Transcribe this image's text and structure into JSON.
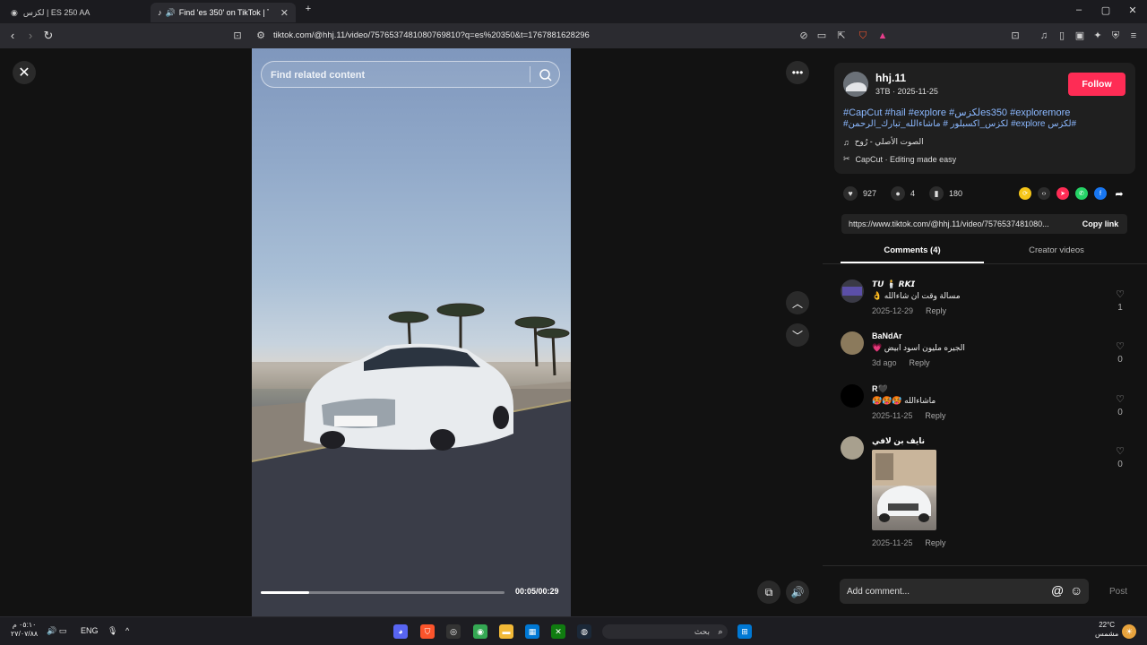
{
  "browser": {
    "tabs": [
      {
        "label": "لكزس | ES 250 AA"
      },
      {
        "label": "Find 'es 350' on TikTok | TikTok"
      }
    ],
    "url": "tiktok.com/@hhj.11/video/7576537481080769810?q=es%20350&t=1767881628296"
  },
  "video": {
    "search_placeholder": "Find related content",
    "progress": 0.2,
    "time": "00:05/00:29"
  },
  "post": {
    "username": "hhj.11",
    "subline": "3TB · 2025-11-25",
    "follow_label": "Follow",
    "caption_line1": "#CapCut #hail #explore #لكزسes350 #exploremore",
    "caption_line2": "#لكزس explore# لكزس_اكسبلور # ماشاءالله_تبارك_الرحمن#",
    "sound": "الصوت الأصلي - رُوح",
    "capcut": "CapCut · Editing made easy",
    "likes": "927",
    "comments_count": "4",
    "saves": "180",
    "link": "https://www.tiktok.com/@hhj.11/video/7576537481080...",
    "copy_link_label": "Copy link"
  },
  "tabs": {
    "comments": "Comments (4)",
    "creator": "Creator videos"
  },
  "comments": [
    {
      "name": "𝙏𝙐 🕯️ 𝙍𝙆𝙄",
      "text": "مسالة وقت ان شاءالله 👌",
      "date": "2025-12-29",
      "reply": "Reply",
      "likes": "1"
    },
    {
      "name": "BaNdAr",
      "text": "الجيره مليون اسود ابيض 💗",
      "date": "3d ago",
      "reply": "Reply",
      "likes": "0"
    },
    {
      "name": "R🖤",
      "text": "ماشاءالله 🥵🥵🥵",
      "date": "2025-11-25",
      "reply": "Reply",
      "likes": "0"
    },
    {
      "name": "نايف بن لافي",
      "text": "",
      "date": "2025-11-25",
      "reply": "Reply",
      "likes": "0"
    }
  ],
  "composer": {
    "placeholder": "Add comment...",
    "post_label": "Post"
  },
  "taskbar": {
    "search_placeholder": "بحث",
    "lang": "ENG",
    "time": "٠٥:١٠ م",
    "date": "٢٧/٠٧/٨٨",
    "weather_temp": "22°C",
    "weather_desc": "مشمس"
  }
}
